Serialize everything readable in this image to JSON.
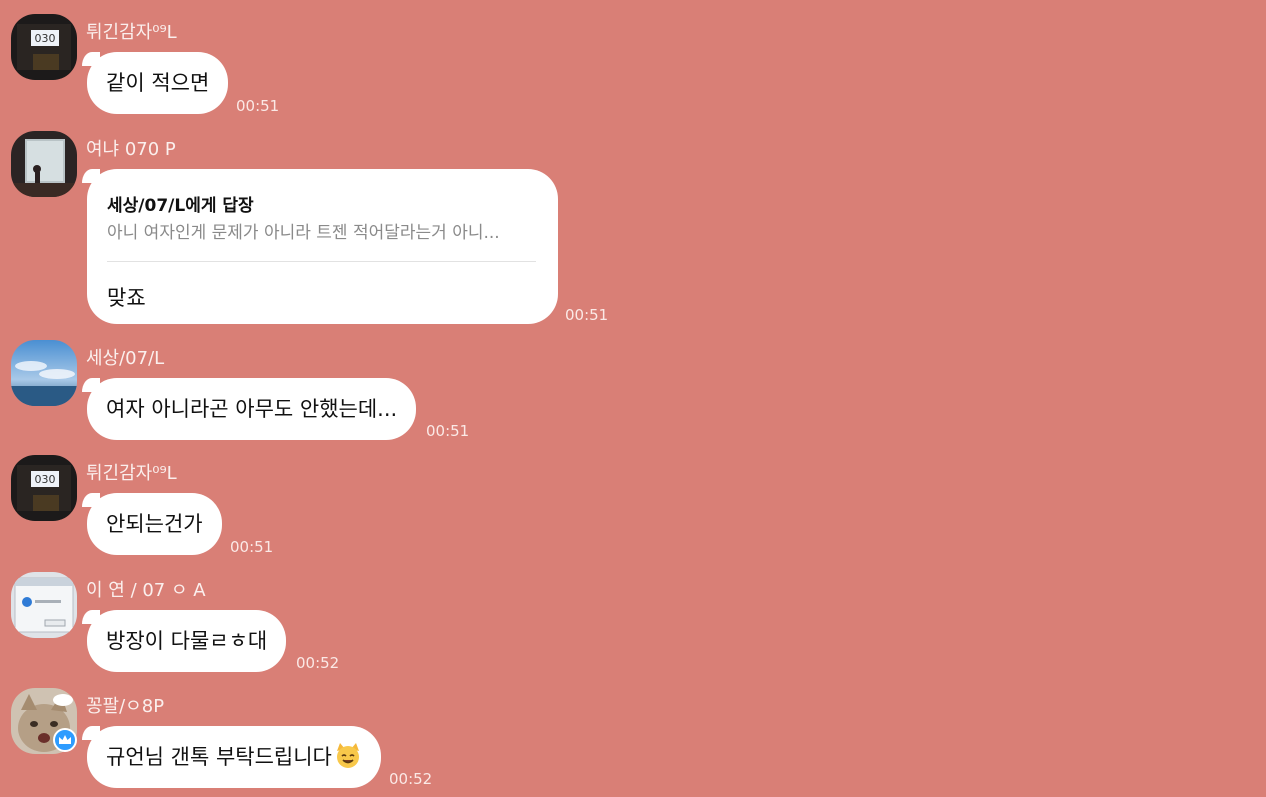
{
  "messages": [
    {
      "sender": "튀긴감자⁰⁹L",
      "text": "같이 적으면",
      "time": "00:51"
    },
    {
      "sender": "여냐 070 P",
      "reply_to": "세상/07/L에게 답장",
      "reply_quote": "아니 여자인게 문제가 아니라 트젠 적어달라는거 아니...",
      "text": "맞죠",
      "time": "00:51"
    },
    {
      "sender": "세상/07/L",
      "text": "여자 아니라곤 아무도 안했는데...",
      "time": "00:51"
    },
    {
      "sender": "튀긴감자⁰⁹L",
      "text": "안되는건가",
      "time": "00:51"
    },
    {
      "sender": "이 연 / 07 ㅇ A",
      "text": "방장이 다물ㄹㅎ대",
      "time": "00:52"
    },
    {
      "sender": "꽁팔/ㅇ8P",
      "text": "규언님 갠톡 부탁드립니다",
      "time": "00:52",
      "badge": "crown-icon",
      "emoji": "cat-face-icon"
    }
  ],
  "colors": {
    "background": "#d97f76",
    "bubble": "#ffffff",
    "badge": "#2d9cff"
  }
}
